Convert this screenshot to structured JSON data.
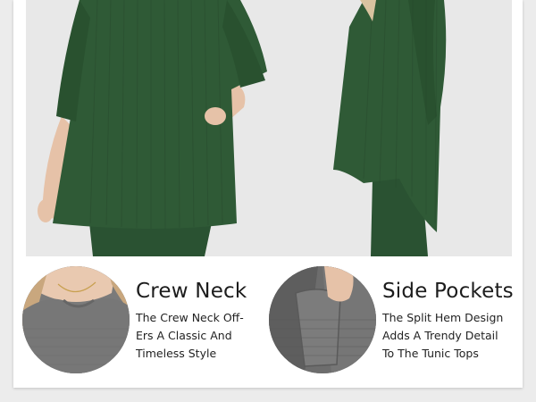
{
  "colors": {
    "garment_green": "#2f5a36",
    "photo_background": "#e8e8e8",
    "card_background": "#ffffff",
    "page_background": "#ececec",
    "text": "#1c1c1c"
  },
  "features": [
    {
      "title": "Crew Neck",
      "description_lines": [
        "The Crew Neck Off-",
        "Ers A Classic And",
        "Timeless Style"
      ]
    },
    {
      "title": "Side Pockets",
      "description_lines": [
        "The Split Hem Design",
        "Adds A Trendy Detail",
        "To The Tunic Tops"
      ]
    }
  ]
}
